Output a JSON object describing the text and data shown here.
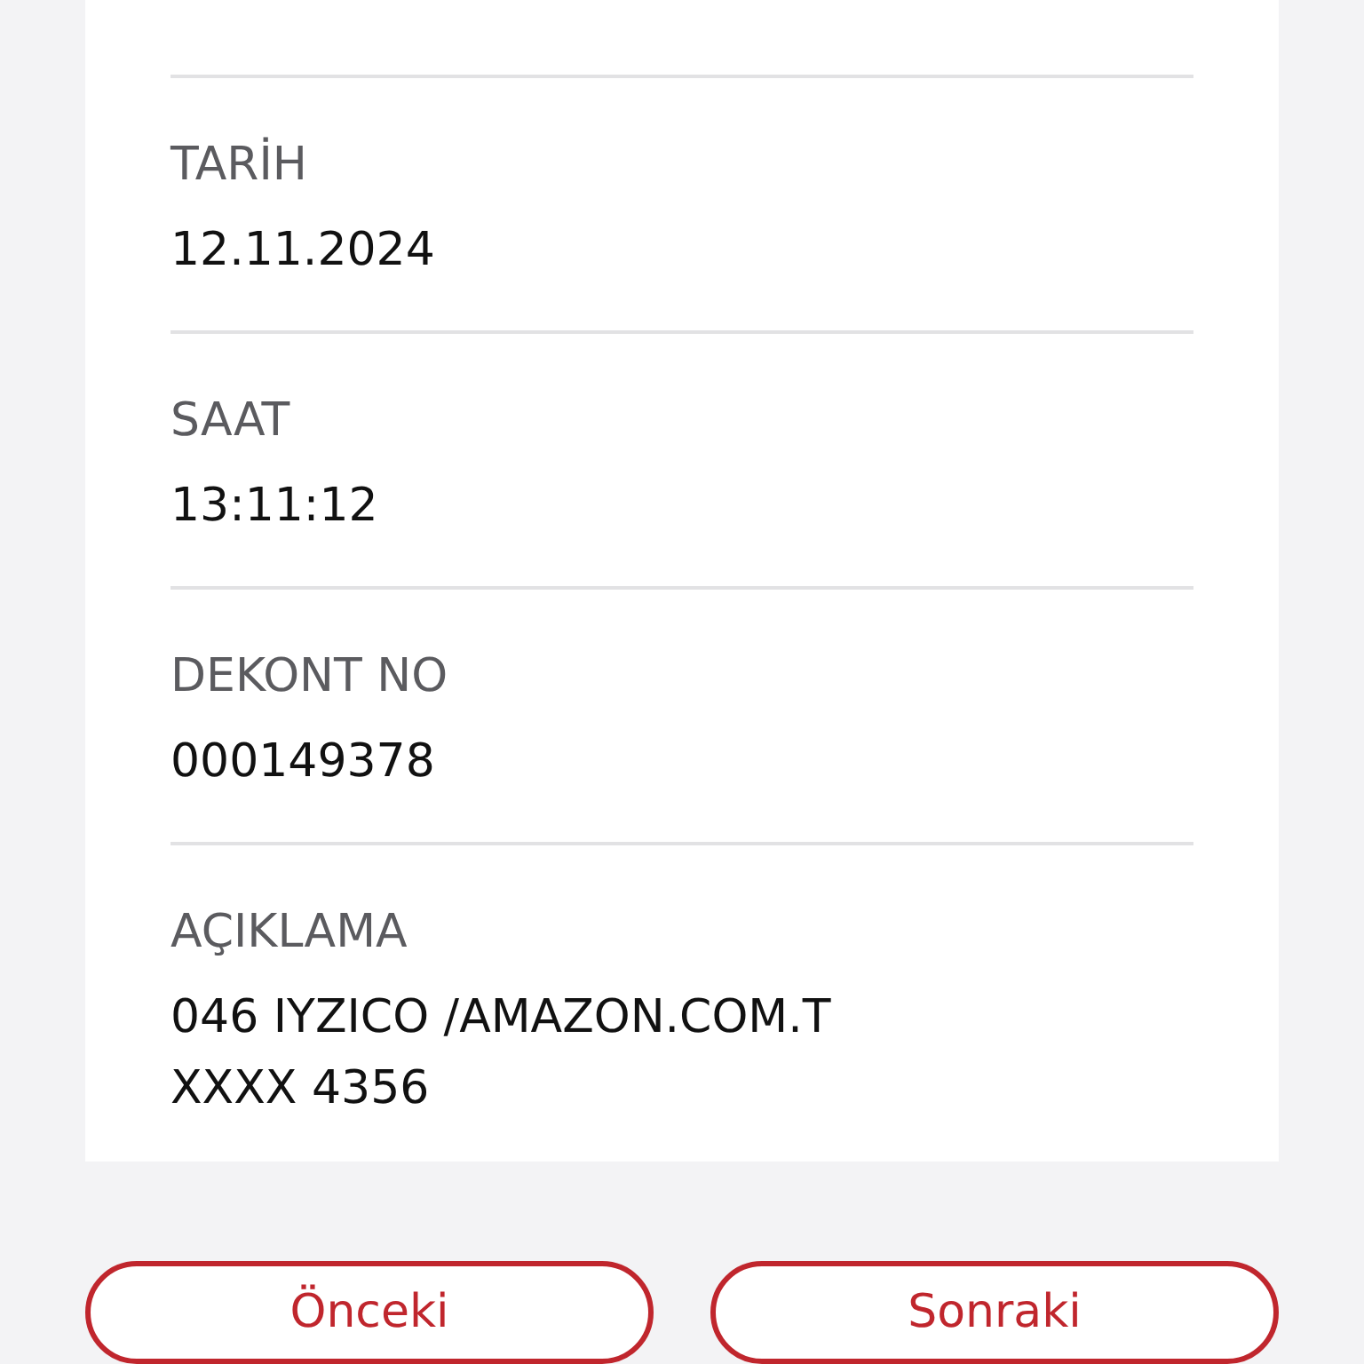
{
  "details": [
    {
      "label": "TARİH",
      "value": "12.11.2024"
    },
    {
      "label": "SAAT",
      "value": "13:11:12"
    },
    {
      "label": "DEKONT NO",
      "value": "000149378"
    },
    {
      "label": "AÇIKLAMA",
      "value": "046 IYZICO /AMAZON.COM.T\nXXXX 4356"
    }
  ],
  "buttons": [
    {
      "label": "Önceki"
    },
    {
      "label": "Sonraki"
    }
  ]
}
